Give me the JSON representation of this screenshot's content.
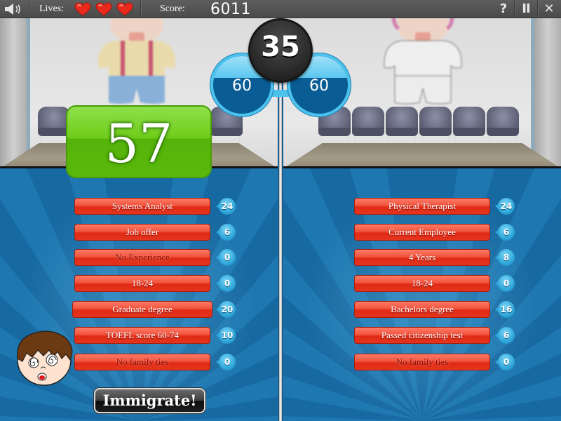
{
  "topbar": {
    "sound_icon": "speaker-icon",
    "lives_label": "Lives:",
    "lives": 3,
    "score_label": "Score:",
    "score_value": "6011",
    "help_label": "?",
    "pause_label": "II",
    "close_label": "✕"
  },
  "timer": {
    "value": "35"
  },
  "left_candidate": {
    "bubble_value": "60",
    "total_score": "57",
    "attributes": [
      {
        "label": "Systems Analyst",
        "points": "24",
        "neutral": false
      },
      {
        "label": "Job offer",
        "points": "6",
        "neutral": false
      },
      {
        "label": "No Experience",
        "points": "0",
        "neutral": true
      },
      {
        "label": "18-24",
        "points": "0",
        "neutral": false
      },
      {
        "label": "Graduate degree",
        "points": "20",
        "neutral": false
      },
      {
        "label": "TOEFL score 60-74",
        "points": "10",
        "neutral": false
      },
      {
        "label": "No family ties",
        "points": "0",
        "neutral": true
      }
    ]
  },
  "right_candidate": {
    "bubble_value": "60",
    "attributes": [
      {
        "label": "Physical Therapist",
        "points": "24",
        "neutral": false
      },
      {
        "label": "Current Employee",
        "points": "6",
        "neutral": false
      },
      {
        "label": "4 Years",
        "points": "8",
        "neutral": false
      },
      {
        "label": "18-24",
        "points": "0",
        "neutral": false
      },
      {
        "label": "Bachelors degree",
        "points": "16",
        "neutral": false
      },
      {
        "label": "Passed citizenship test",
        "points": "6",
        "neutral": false
      },
      {
        "label": "No family ties",
        "points": "0",
        "neutral": true
      }
    ]
  },
  "actions": {
    "immigrate_label": "Immigrate!"
  },
  "colors": {
    "attribute_pill": "#e4351f",
    "points_badge": "#2fa7da",
    "total_green": "#6fcc1a",
    "stage_blue": "#1769a1"
  }
}
